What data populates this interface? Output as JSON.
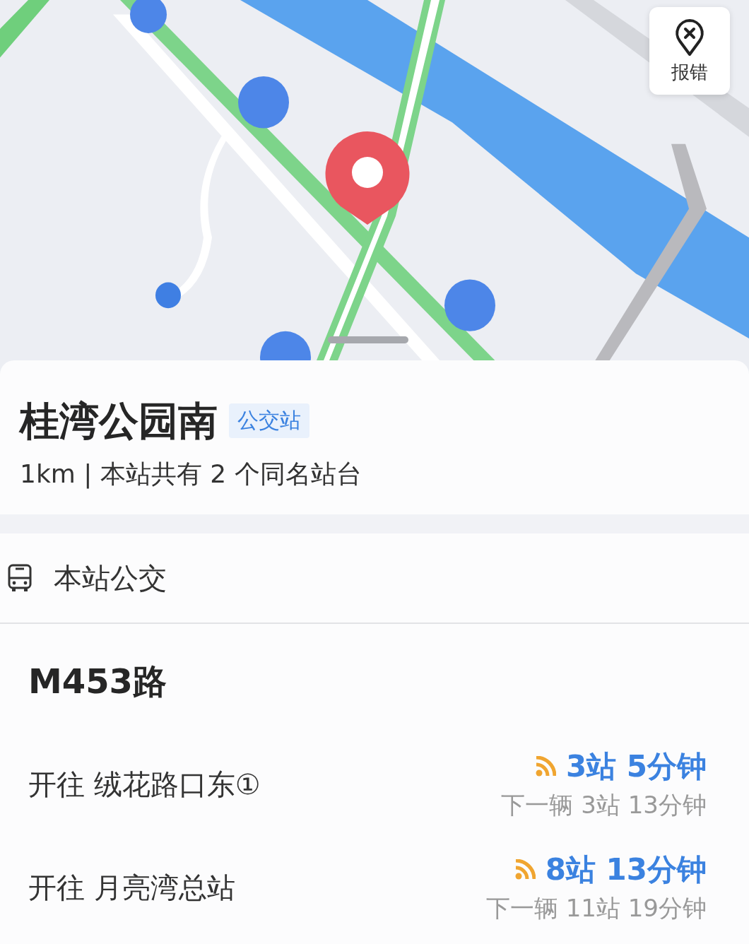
{
  "map": {
    "kind": "picture",
    "report_button": {
      "label": "报错"
    }
  },
  "stop": {
    "name": "桂湾公园南",
    "tag": "公交站",
    "info": "1km | 本站共有 2 个同名站台"
  },
  "section": {
    "title": "本站公交"
  },
  "routes": [
    {
      "name": "M453路",
      "directions": [
        {
          "label": "开往 绒花路口东①",
          "realtime": true,
          "eta": "3站 5分钟",
          "next": "下一辆 3站 13分钟"
        },
        {
          "label": "开往 月亮湾总站",
          "realtime": true,
          "eta": "8站 13分钟",
          "next": "下一辆 11站 19分钟"
        }
      ]
    }
  ]
}
